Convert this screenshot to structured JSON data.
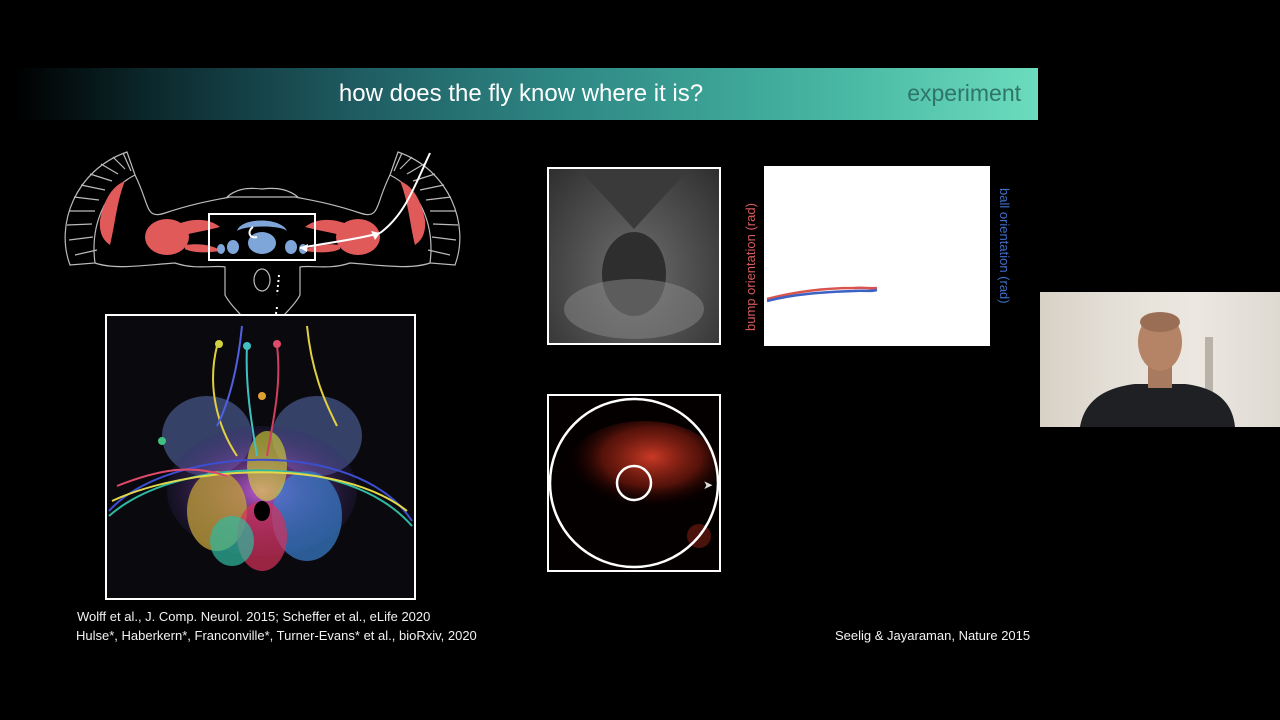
{
  "banner": {
    "title": "how does the fly know where it is?",
    "tag": "experiment"
  },
  "citations": {
    "left_line1": "Wolff et al., J. Comp. Neurol. 2015; Scheffer et al., eLife 2020",
    "left_line2": "Hulse*, Haberkern*, Franconville*, Turner-Evans* et al., bioRxiv, 2020",
    "right": "Seelig & Jayaraman, Nature 2015"
  },
  "plot": {
    "ylabel_left": "bump orientation (rad)",
    "ylabel_right": "ball orientation (rad)",
    "colors": {
      "bump": "#d9534f",
      "ball": "#3b62c4"
    }
  },
  "colors": {
    "brain_region": "#e05a5a",
    "central_complex": "#7fa6d9",
    "banner_end": "#6cdcbe"
  },
  "icons": {
    "cursor": "mouse-pointer-icon"
  }
}
